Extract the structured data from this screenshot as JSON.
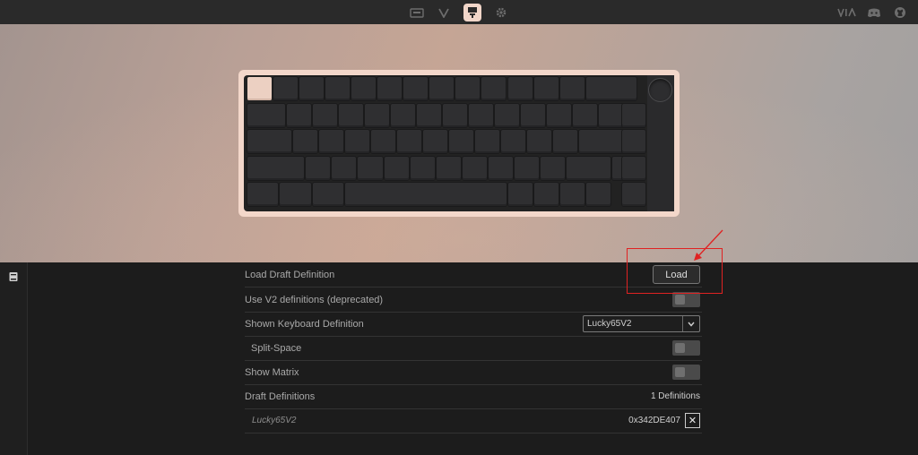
{
  "topbar": {
    "nav": [
      {
        "icon": "keyboard-icon"
      },
      {
        "icon": "via-logo-icon"
      },
      {
        "icon": "paintbrush-icon",
        "active": true
      },
      {
        "icon": "gear-icon"
      }
    ],
    "right": [
      {
        "icon": "via-text-logo-icon"
      },
      {
        "icon": "discord-icon"
      },
      {
        "icon": "github-icon"
      }
    ]
  },
  "keyboard": {
    "frame_color": "#f3d7ca",
    "accent_key_color": "#ecd0c2",
    "key_color": "#2f2f31"
  },
  "sidebar": {
    "icon": "book-icon"
  },
  "settings": {
    "load_draft": {
      "label": "Load Draft Definition",
      "button": "Load"
    },
    "use_v2": {
      "label": "Use V2 definitions (deprecated)",
      "enabled": false
    },
    "shown_definition": {
      "label": "Shown Keyboard Definition",
      "value": "Lucky65V2"
    },
    "split_space": {
      "label": "Split-Space",
      "enabled": false
    },
    "show_matrix": {
      "label": "Show Matrix",
      "enabled": false
    },
    "draft_definitions": {
      "label": "Draft Definitions",
      "count": "1 Definitions"
    },
    "definition_item": {
      "name": "Lucky65V2",
      "id": "0x342DE407",
      "remove": "✕"
    }
  },
  "highlight_color": "#e02222"
}
